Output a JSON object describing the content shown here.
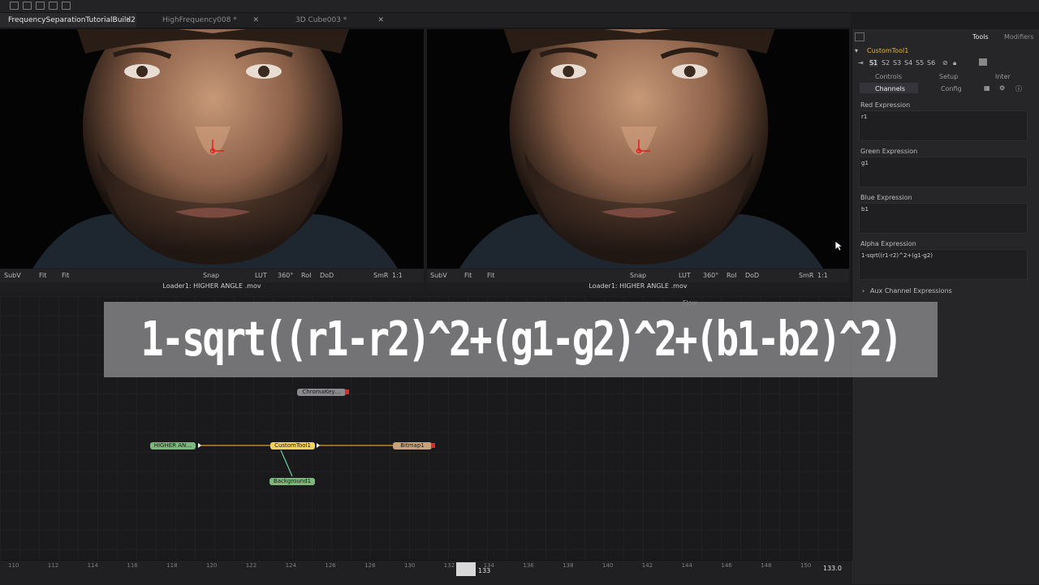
{
  "tabs": [
    {
      "label": "FrequencySeparationTutorialBuild2 *",
      "active": true
    },
    {
      "label": "HighFrequency008 *",
      "active": false
    },
    {
      "label": "3D Cube003 *",
      "active": false
    }
  ],
  "viewer_toolbar": {
    "subv": "SubV",
    "fit1": "Fit",
    "fit2": "Fit",
    "snap": "Snap",
    "lut": "LUT",
    "angle": "360°",
    "roi": "RoI",
    "dod": "DoD",
    "smr": "SmR",
    "ratio": "1:1"
  },
  "viewers": [
    {
      "caption": "Loader1: HIGHER ANGLE .mov"
    },
    {
      "caption": "Loader1: HIGHER ANGLE .mov"
    }
  ],
  "right_panel": {
    "tabs": {
      "tools": "Tools",
      "modifiers": "Modifiers"
    },
    "tool_name": "CustomTool1",
    "slots": [
      "S1",
      "S2",
      "S3",
      "S4",
      "S5",
      "S6"
    ],
    "subtabs_row1": [
      "Controls",
      "Setup",
      "Inter"
    ],
    "subtabs_row2": [
      "Channels",
      "Config"
    ],
    "expressions": [
      {
        "label": "Red Expression",
        "value": "r1"
      },
      {
        "label": "Green Expression",
        "value": "g1"
      },
      {
        "label": "Blue Expression",
        "value": "b1"
      },
      {
        "label": "Alpha Expression",
        "value": "1-sqrt((r1-r2)^2+(g1-g2)"
      }
    ],
    "aux": "Aux Channel Expressions"
  },
  "flow": {
    "label": "Flow",
    "banner": "1-sqrt((r1-r2)^2+(g1-g2)^2+(b1-b2)^2)",
    "nodes": {
      "chromakey": "ChromaKey…",
      "loader": "HIGHER AN…",
      "custom": "CustomTool1",
      "bitmap": "Bitmap1",
      "background": "Background1"
    }
  },
  "timeline": {
    "ticks": [
      "110",
      "112",
      "114",
      "116",
      "118",
      "120",
      "122",
      "124",
      "126",
      "128",
      "130",
      "132",
      "134",
      "136",
      "138",
      "140",
      "142",
      "144",
      "146",
      "148",
      "150"
    ],
    "current": "133",
    "current_value": "133.0"
  },
  "colors": {
    "accent": "#f0b23a",
    "node_green": "#7bb87b",
    "node_yellow": "#f2d25a",
    "node_tan": "#c8a27a"
  }
}
